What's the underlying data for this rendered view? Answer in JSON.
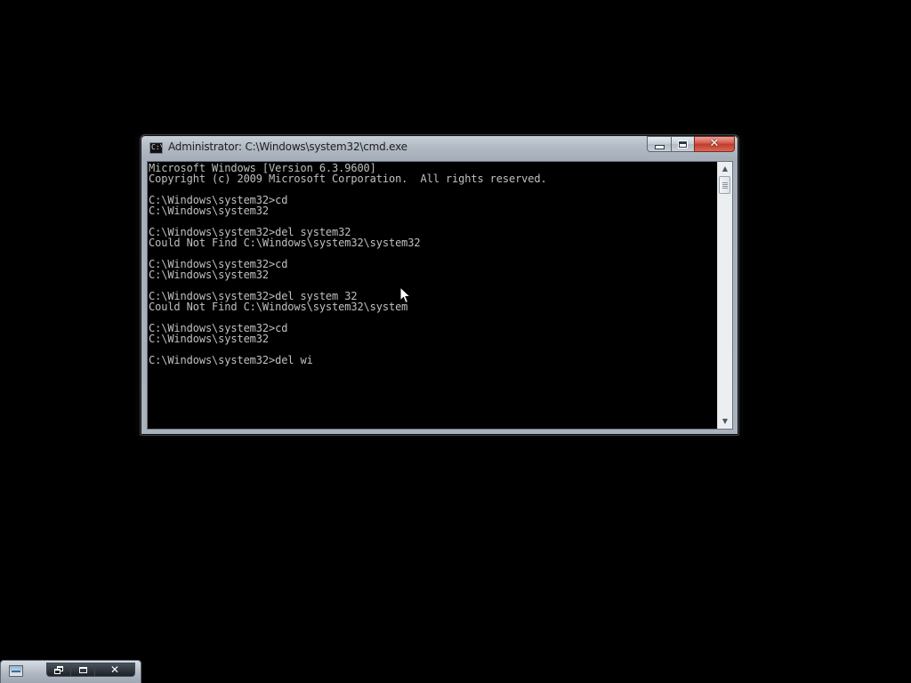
{
  "window": {
    "title": "Administrator: C:\\Windows\\system32\\cmd.exe",
    "icon": "cmd-icon",
    "icon_glyph": "C:\\",
    "buttons": {
      "minimize_icon": "minimize-icon",
      "maximize_icon": "maximize-icon",
      "close_icon": "close-icon",
      "close_glyph": "✕"
    }
  },
  "console": {
    "foreground": "#c0c0c0",
    "background": "#000000",
    "lines": [
      "Microsoft Windows [Version 6.3.9600]",
      "Copyright (c) 2009 Microsoft Corporation.  All rights reserved.",
      "",
      "C:\\Windows\\system32>cd",
      "C:\\Windows\\system32",
      "",
      "C:\\Windows\\system32>del system32",
      "Could Not Find C:\\Windows\\system32\\system32",
      "",
      "C:\\Windows\\system32>cd",
      "C:\\Windows\\system32",
      "",
      "C:\\Windows\\system32>del system 32",
      "Could Not Find C:\\Windows\\system32\\system",
      "",
      "C:\\Windows\\system32>cd",
      "C:\\Windows\\system32",
      "",
      "C:\\Windows\\system32>del wi"
    ]
  },
  "scrollbar": {
    "up_arrow": "▲",
    "down_arrow": "▼"
  },
  "minimized_window": {
    "icon": "minimized-app-icon",
    "restore_icon": "restore-icon",
    "maximize_icon": "maximize-icon",
    "close_icon": "close-icon",
    "close_glyph": "✕"
  },
  "cursor": "mouse-pointer"
}
